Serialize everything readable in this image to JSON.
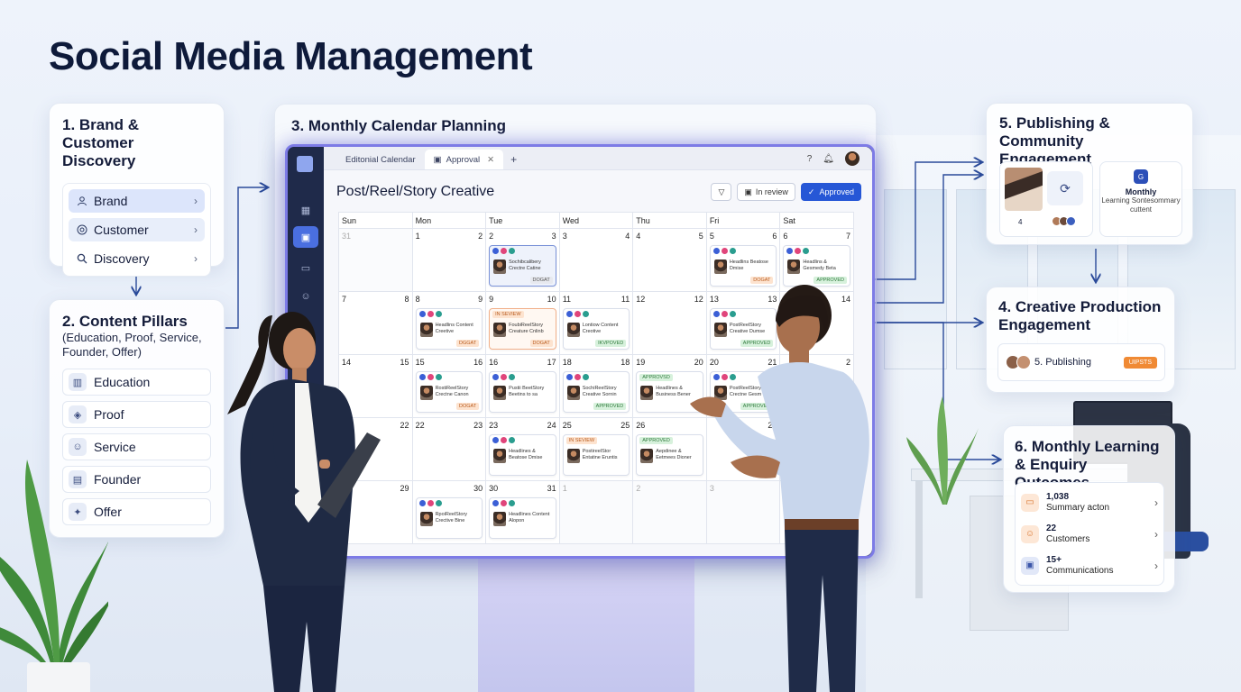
{
  "page_title": "Social Media Management",
  "brand_discovery": {
    "title": "1. Brand & Customer Discovery",
    "items": [
      {
        "label": "Brand",
        "icon": "user-icon"
      },
      {
        "label": "Customer",
        "icon": "target-icon"
      },
      {
        "label": "Discovery",
        "icon": "search-icon"
      }
    ]
  },
  "content_pillars": {
    "title": "2. Content Pillars",
    "subtitle": "(Education, Proof, Service, Founder, Offer)",
    "items": [
      {
        "label": "Education",
        "icon": "chart-icon"
      },
      {
        "label": "Proof",
        "icon": "shield-icon"
      },
      {
        "label": "Service",
        "icon": "people-icon"
      },
      {
        "label": "Founder",
        "icon": "card-icon"
      },
      {
        "label": "Offer",
        "icon": "gift-icon"
      }
    ]
  },
  "calendar_planning": {
    "title": "3. Monthly Calendar Planning",
    "app": {
      "tabs": [
        {
          "label": "Editonial Calendar"
        },
        {
          "label": "Approval"
        }
      ],
      "page_title": "Post/Reel/Story Creative",
      "filters": {
        "in_review": "In review",
        "approved": "Approved"
      },
      "weekdays": [
        "Sun",
        "Mon",
        "Tue",
        "Wed",
        "Thu",
        "Fri",
        "Sat"
      ],
      "weeks": [
        [
          {
            "l": "31",
            "r": "",
            "dim": true
          },
          {
            "l": "1",
            "r": "2"
          },
          {
            "l": "2",
            "r": "3",
            "post": {
              "text": "Sochibcalibery Crectre Catine",
              "badge": "DOGAT",
              "style": "sel",
              "badge_color": "gy"
            }
          },
          {
            "l": "3",
            "r": "4"
          },
          {
            "l": "4",
            "r": "5"
          },
          {
            "l": "5",
            "r": "6",
            "post": {
              "text": "Headlins Beatose Dmise",
              "badge": "DOGAT",
              "badge_color": "or"
            }
          },
          {
            "l": "6",
            "r": "7",
            "post": {
              "text": "Headlins & Gesmedy Beta",
              "badge": "APPROVED",
              "badge_color": "gr"
            }
          }
        ],
        [
          {
            "l": "7",
            "r": "8"
          },
          {
            "l": "8",
            "r": "9",
            "post": {
              "text": "Headlins Content Creetive",
              "badge": "DGGAT",
              "badge_color": "or"
            }
          },
          {
            "l": "9",
            "r": "10",
            "post": {
              "status": "IN SEVIEW",
              "text": "FoubiReelStory Creature Cnlinb",
              "badge": "DOGAT",
              "style": "warm",
              "badge_color": "or"
            }
          },
          {
            "l": "11",
            "r": "11",
            "post": {
              "text": "Lontiow Content Creotive",
              "badge": "IKVPOVED",
              "badge_color": "gr"
            }
          },
          {
            "l": "12",
            "r": "12"
          },
          {
            "l": "13",
            "r": "13",
            "post": {
              "text": "PostReelStory Creative Dumse",
              "badge": "APPROVED",
              "badge_color": "gr"
            }
          },
          {
            "l": "",
            "r": "14"
          }
        ],
        [
          {
            "l": "14",
            "r": "15"
          },
          {
            "l": "15",
            "r": "16",
            "post": {
              "text": "RostiReelStory Crectne Canon",
              "badge": "DOGAT",
              "badge_color": "or"
            }
          },
          {
            "l": "16",
            "r": "17",
            "post": {
              "text": "Pustii BeetStory Beetins to sa",
              "badge": "",
              "badge_color": "gy"
            }
          },
          {
            "l": "18",
            "r": "18",
            "post": {
              "text": "SochiReelStory Creative Sornin",
              "badge": "APPROVED",
              "badge_color": "gr"
            }
          },
          {
            "l": "19",
            "r": "20",
            "post": {
              "status": "APPROVSD",
              "text": "Headlines & Business Bener",
              "badge": "",
              "badge_color": "gy"
            }
          },
          {
            "l": "20",
            "r": "21",
            "post": {
              "text": "PostReelStory Crectne Gesm",
              "badge": "APPROVED",
              "badge_color": "gr"
            }
          },
          {
            "l": "",
            "r": "2"
          }
        ],
        [
          {
            "l": "21",
            "r": "22"
          },
          {
            "l": "22",
            "r": "23"
          },
          {
            "l": "23",
            "r": "24",
            "post": {
              "text": "Headlines & Beatose Dmise",
              "badge": "",
              "badge_color": "gy"
            }
          },
          {
            "l": "25",
            "r": "25",
            "post": {
              "status": "IN SEVIEW",
              "text": "PostireelStor Entatine Eruntis",
              "badge": "",
              "badge_color": "gy"
            }
          },
          {
            "l": "26",
            "r": "",
            "post": {
              "status": "APPROVED",
              "text": "Aepdinee & Eetmees Dioner",
              "badge": "",
              "badge_color": "gy"
            }
          },
          {
            "l": "",
            "r": "27"
          },
          {
            "l": "",
            "r": ""
          }
        ],
        [
          {
            "l": "",
            "r": "29"
          },
          {
            "l": "",
            "r": "30",
            "post": {
              "text": "RpoiReelStory Crective Bine",
              "badge": "",
              "badge_color": "gy"
            }
          },
          {
            "l": "30",
            "r": "31",
            "post": {
              "text": "Headlines Content Alopon",
              "badge": "",
              "badge_color": "gy"
            }
          },
          {
            "l": "1",
            "r": "",
            "dim": true
          },
          {
            "l": "2",
            "r": "",
            "dim": true
          },
          {
            "l": "3",
            "r": "",
            "dim": true
          },
          {
            "l": "",
            "r": ""
          }
        ]
      ]
    }
  },
  "publishing": {
    "title": "5. Publishing & Community Engagement",
    "count": "4",
    "side_title": "Monthly",
    "side_text": "Learning Sontesommary cuttent"
  },
  "creative_production": {
    "title": "4. Creative Production Engagement",
    "row_label": "5. Publishing",
    "badge": "UIPSTS"
  },
  "outcomes": {
    "title": "6. Monthly Learning & Enquiry Outcomes",
    "items": [
      {
        "value": "1,038",
        "label": "Summary acton",
        "icon": "chat-icon"
      },
      {
        "value": "22",
        "label": "Customers",
        "icon": "users-icon"
      },
      {
        "value": "15+",
        "label": "Communications",
        "icon": "calendar-icon"
      }
    ]
  },
  "colors": {
    "accent": "#2657d6",
    "screen_glow": "#7d7be6",
    "approved": "#2f7a3c",
    "draft": "#b85a1c"
  }
}
